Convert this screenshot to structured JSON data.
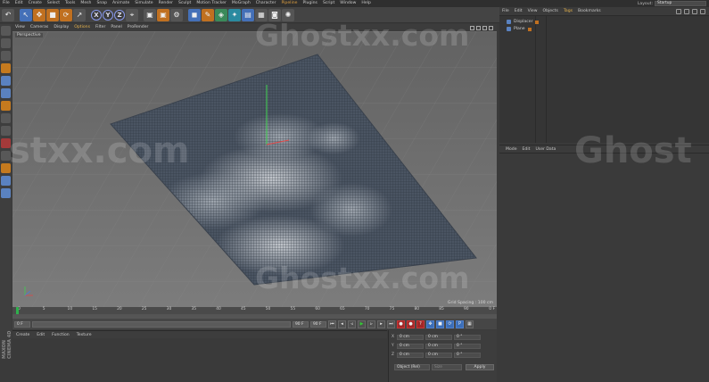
{
  "menubar": {
    "items": [
      "File",
      "Edit",
      "Create",
      "Select",
      "Tools",
      "Mesh",
      "Snap",
      "Animate",
      "Simulate",
      "Render",
      "Sculpt",
      "Motion Tracker",
      "MoGraph",
      "Character",
      "Pipeline",
      "Plugins",
      "Script",
      "Window",
      "Help"
    ],
    "layout_label": "Layout:",
    "layout_value": "Startup"
  },
  "toolbar": {
    "undo_icon": "undo-icon",
    "axis_x": "X",
    "axis_y": "Y",
    "axis_z": "Z"
  },
  "viewport": {
    "menu": [
      "View",
      "Cameras",
      "Display",
      "Options",
      "Filter",
      "Panel",
      "ProRender"
    ],
    "camera_label": "Perspective",
    "grid_spacing": "Grid Spacing : 100 cm",
    "mesh_colors": {
      "base": "#4a5462",
      "highlight": "#b8c0c8",
      "grid": "#2f3640"
    }
  },
  "timeline": {
    "ticks": [
      "0",
      "5",
      "10",
      "15",
      "20",
      "25",
      "30",
      "35",
      "40",
      "45",
      "50",
      "55",
      "60",
      "65",
      "70",
      "75",
      "80",
      "85",
      "90"
    ],
    "frame_readout": "0 F",
    "start_field": "0 F",
    "end_field": "90 F",
    "current_field": "90 F"
  },
  "materials": {
    "menu": [
      "Create",
      "Edit",
      "Function",
      "Texture"
    ]
  },
  "coordinates": {
    "rows": [
      {
        "label": "X",
        "pos": "0 cm",
        "size": "0 cm",
        "rot": "0 °"
      },
      {
        "label": "Y",
        "pos": "0 cm",
        "size": "0 cm",
        "rot": "0 °"
      },
      {
        "label": "Z",
        "pos": "0 cm",
        "size": "0 cm",
        "rot": "0 °"
      }
    ],
    "mode": "Object (Rel)",
    "size_mode": "Size",
    "apply_label": "Apply"
  },
  "object_manager": {
    "menu": [
      "File",
      "Edit",
      "View",
      "Objects",
      "Tags",
      "Bookmarks"
    ],
    "objects": [
      {
        "name": "Displacer"
      },
      {
        "name": "Plane"
      }
    ]
  },
  "attribute_manager": {
    "menu": [
      "Mode",
      "Edit",
      "User Data"
    ]
  },
  "brand": "MAXON CINEMA 4D",
  "watermarks": [
    "Ghostxx.com",
    "stxx.com",
    "Ghost",
    "Ghostxx.com"
  ]
}
